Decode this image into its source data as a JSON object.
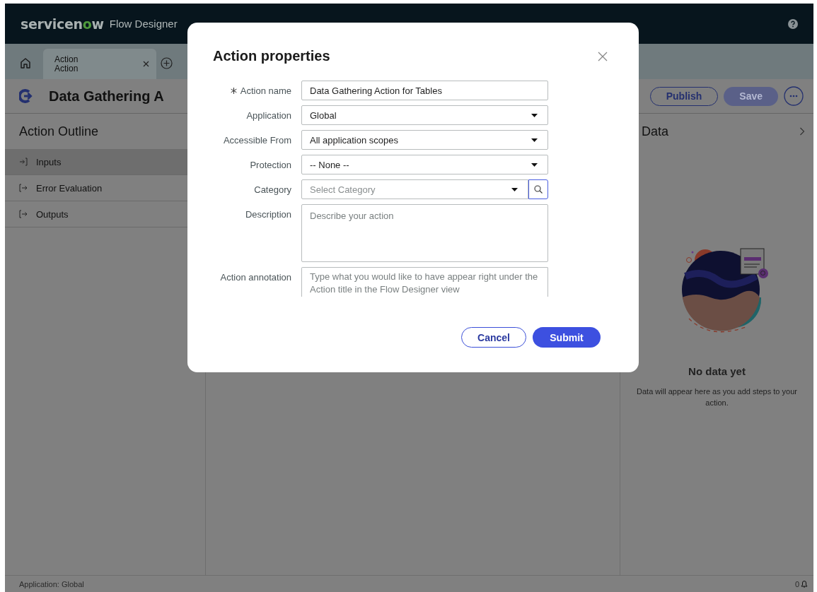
{
  "app": {
    "logo": "servicenow",
    "product": "Flow Designer"
  },
  "tabs": [
    {
      "title": "Action",
      "subtitle": "Action",
      "selected": true
    }
  ],
  "header": {
    "title": "Data Gathering A",
    "buttons": [
      {
        "label": "Publish",
        "kind": "outline",
        "disabled": false
      },
      {
        "label": "Save",
        "kind": "primary",
        "disabled": true
      }
    ]
  },
  "outline": {
    "title": "Action Outline",
    "items": [
      {
        "label": "Inputs",
        "kind": "input",
        "selected": true
      },
      {
        "label": "Error Evaluation",
        "kind": "output",
        "selected": false
      },
      {
        "label": "Outputs",
        "kind": "output",
        "selected": false
      }
    ]
  },
  "data_panel": {
    "title": "Data",
    "empty_title": "No data yet",
    "empty_text": "Data will appear here as you add steps to your action."
  },
  "status_bar": {
    "text": "Application: Global",
    "notifications": "0"
  },
  "dialog": {
    "title": "Action properties",
    "fields": [
      {
        "label": "Action name",
        "kind": "text",
        "required": true,
        "value": "Data Gathering Action for Tables"
      },
      {
        "label": "Application",
        "kind": "select",
        "required": false,
        "value": "Global"
      },
      {
        "label": "Accessible From",
        "kind": "select",
        "required": false,
        "value": "All application scopes"
      },
      {
        "label": "Protection",
        "kind": "select",
        "required": false,
        "value": "-- None --"
      },
      {
        "label": "Category",
        "kind": "lookup",
        "required": false,
        "placeholder": "Select Category"
      },
      {
        "label": "Description",
        "kind": "textarea",
        "required": false,
        "placeholder": "Describe your action"
      },
      {
        "label": "Action annotation",
        "kind": "annotation",
        "required": false,
        "placeholder": "Type what you would like to have appear right under the Action title in the Flow Designer view"
      }
    ],
    "buttons": [
      {
        "label": "Cancel",
        "kind": "secondary"
      },
      {
        "label": "Submit",
        "kind": "primary"
      }
    ]
  }
}
